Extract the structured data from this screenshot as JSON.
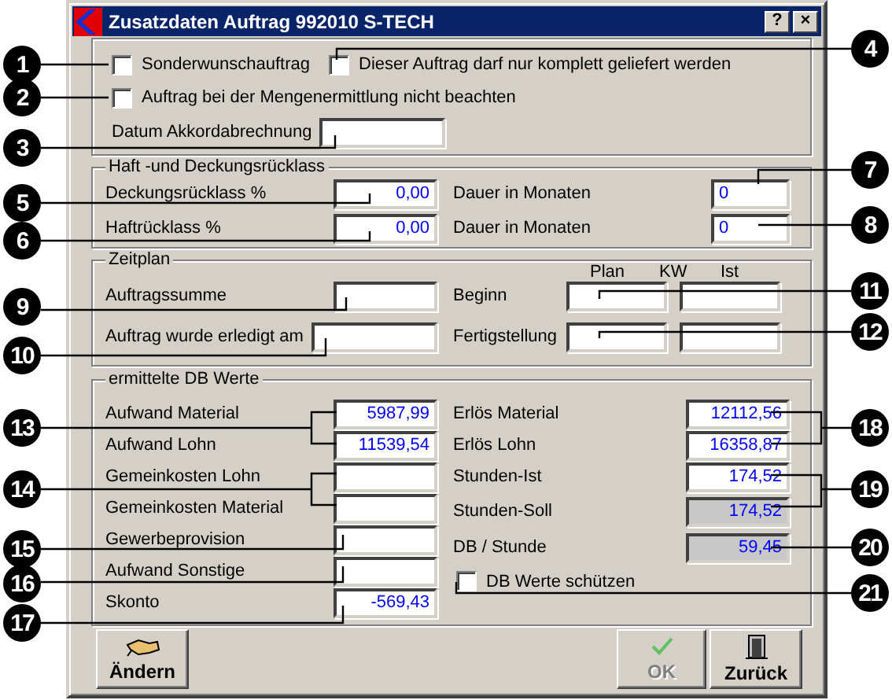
{
  "window": {
    "title": "Zusatzdaten Auftrag 992010 S-TECH",
    "help_button": "?",
    "close_button": "×"
  },
  "options": {
    "checkboxes": [
      {
        "label": "Sonderwunschauftrag",
        "checked": false
      },
      {
        "label": "Dieser Auftrag darf nur komplett geliefert werden",
        "checked": false
      },
      {
        "label": "Auftrag bei der Mengenermittlung nicht beachten",
        "checked": false
      }
    ],
    "date_label": "Datum Akkordabrechnung"
  },
  "retention": {
    "title": "Haft -und Deckungsrücklass",
    "rows": [
      {
        "label": "Deckungsrücklass %",
        "value": "0,00",
        "duration_label": "Dauer in Monaten",
        "duration": "0"
      },
      {
        "label": "Haftrücklass %",
        "value": "0,00",
        "duration_label": "Dauer in Monaten",
        "duration": "0"
      }
    ]
  },
  "schedule": {
    "title": "Zeitplan",
    "headers": [
      "Plan",
      "KW",
      "Ist"
    ],
    "left_rows": [
      {
        "label": "Auftragssumme"
      },
      {
        "label": "Auftrag wurde erledigt am"
      }
    ],
    "right_rows": [
      {
        "label": "Beginn"
      },
      {
        "label": "Fertigstellung"
      }
    ]
  },
  "db_values": {
    "title": "ermittelte DB Werte",
    "left_rows": [
      {
        "label": "Aufwand Material",
        "value": "5987,99"
      },
      {
        "label": "Aufwand Lohn",
        "value": "11539,54"
      },
      {
        "label": "Gemeinkosten Lohn"
      },
      {
        "label": "Gemeinkosten Material"
      },
      {
        "label": "Gewerbeprovision"
      },
      {
        "label": "Aufwand Sonstige"
      },
      {
        "label": "Skonto",
        "value": "-569,43"
      }
    ],
    "right_rows": [
      {
        "label": "Erlös Material",
        "value": "12112,56",
        "readonly": false
      },
      {
        "label": "Erlös Lohn",
        "value": "16358,87",
        "readonly": false
      },
      {
        "label": "Stunden-Ist",
        "value": "174,52",
        "readonly": false
      },
      {
        "label": "Stunden-Soll",
        "value": "174,52",
        "readonly": true
      },
      {
        "label": "DB / Stunde",
        "value": "59,45",
        "readonly": true
      }
    ],
    "protect_checkbox": {
      "label": "DB Werte schützen",
      "checked": false
    }
  },
  "buttons": [
    {
      "label": "Ändern",
      "kind": "edit",
      "disabled": false
    },
    {
      "label": "OK",
      "kind": "ok",
      "disabled": true
    },
    {
      "label": "Zurück",
      "kind": "back",
      "disabled": false
    }
  ],
  "callouts": [
    "1",
    "2",
    "3",
    "5",
    "6",
    "9",
    "10",
    "13",
    "14",
    "15",
    "16",
    "17",
    "4",
    "7",
    "8",
    "11",
    "12",
    "18",
    "19",
    "20",
    "21"
  ]
}
